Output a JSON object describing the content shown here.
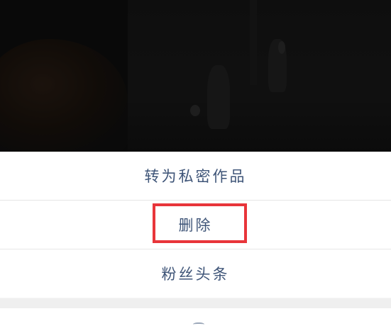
{
  "action_sheet": {
    "items": [
      {
        "label": "转为私密作品"
      },
      {
        "label": "删除"
      },
      {
        "label": "粉丝头条"
      }
    ]
  },
  "colors": {
    "item_text": "#3f5578",
    "highlight": "#e8353a",
    "sheet_background": "#ffffff",
    "overlay": "#0c0c0c"
  }
}
